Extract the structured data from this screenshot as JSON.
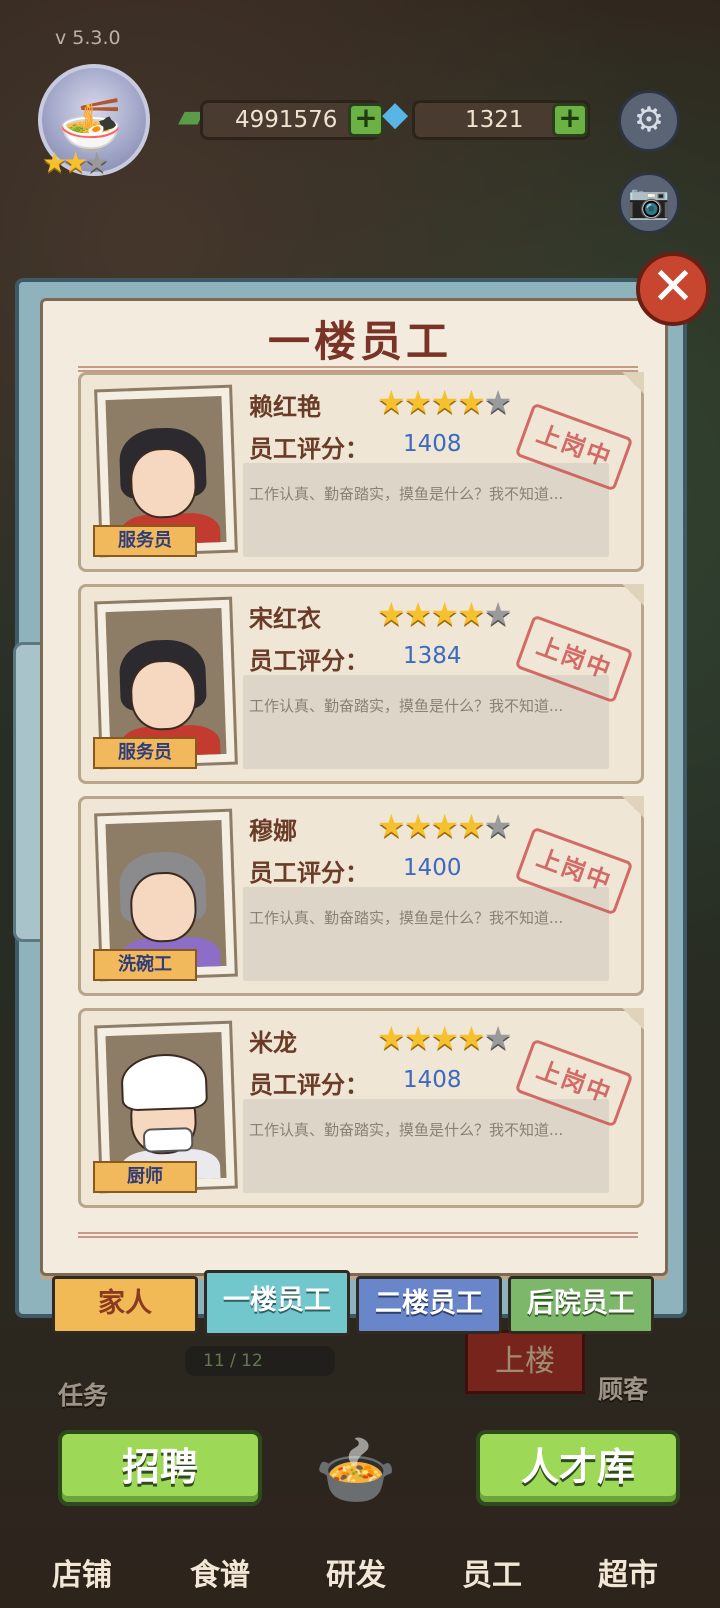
{
  "version": "v  5.3.0",
  "currency": {
    "money": "4991576",
    "gems": "1321",
    "plus": "+"
  },
  "icons": {
    "settings": "gear-icon",
    "camera": "camera-icon",
    "close": "close-icon",
    "money": "cash-icon",
    "gem": "gem-icon",
    "bowl": "noodle-bowl-icon",
    "pot": "pot-icon"
  },
  "glyphs": {
    "close": "✕",
    "gear": "⚙",
    "camera": "📷",
    "money": "▰",
    "gem": "◆",
    "bowl": "🍜",
    "pot": "🍲",
    "star_on": "★",
    "star_off": "★"
  },
  "panel": {
    "title": "一楼员工",
    "score_label": "员工评分：",
    "stamp_text": "上岗中"
  },
  "employees": [
    {
      "name": "赖红艳",
      "role": "服务员",
      "score": "1408",
      "stars": 4,
      "max_stars": 5,
      "description": "工作认真、勤奋踏实，摸鱼是什么？我不知道..."
    },
    {
      "name": "宋红衣",
      "role": "服务员",
      "score": "1384",
      "stars": 4,
      "max_stars": 5,
      "description": "工作认真、勤奋踏实，摸鱼是什么？我不知道..."
    },
    {
      "name": "穆娜",
      "role": "洗碗工",
      "score": "1400",
      "stars": 4,
      "max_stars": 5,
      "description": "工作认真、勤奋踏实，摸鱼是什么？我不知道..."
    },
    {
      "name": "米龙",
      "role": "厨师",
      "score": "1408",
      "stars": 4,
      "max_stars": 5,
      "description": "工作认真、勤奋踏实，摸鱼是什么？我不知道..."
    }
  ],
  "tabs": {
    "family": "家人",
    "floor1": "一楼员工",
    "floor2": "二楼员工",
    "yard": "后院员工"
  },
  "background": {
    "progress": "11 / 12",
    "task": "任务",
    "customer": "顾客",
    "upstairs": "上楼"
  },
  "actions": {
    "recruit": "招聘",
    "talent_pool": "人才库"
  },
  "nav": {
    "store": "店铺",
    "recipes": "食谱",
    "research": "研发",
    "staff": "员工",
    "market": "超市"
  }
}
